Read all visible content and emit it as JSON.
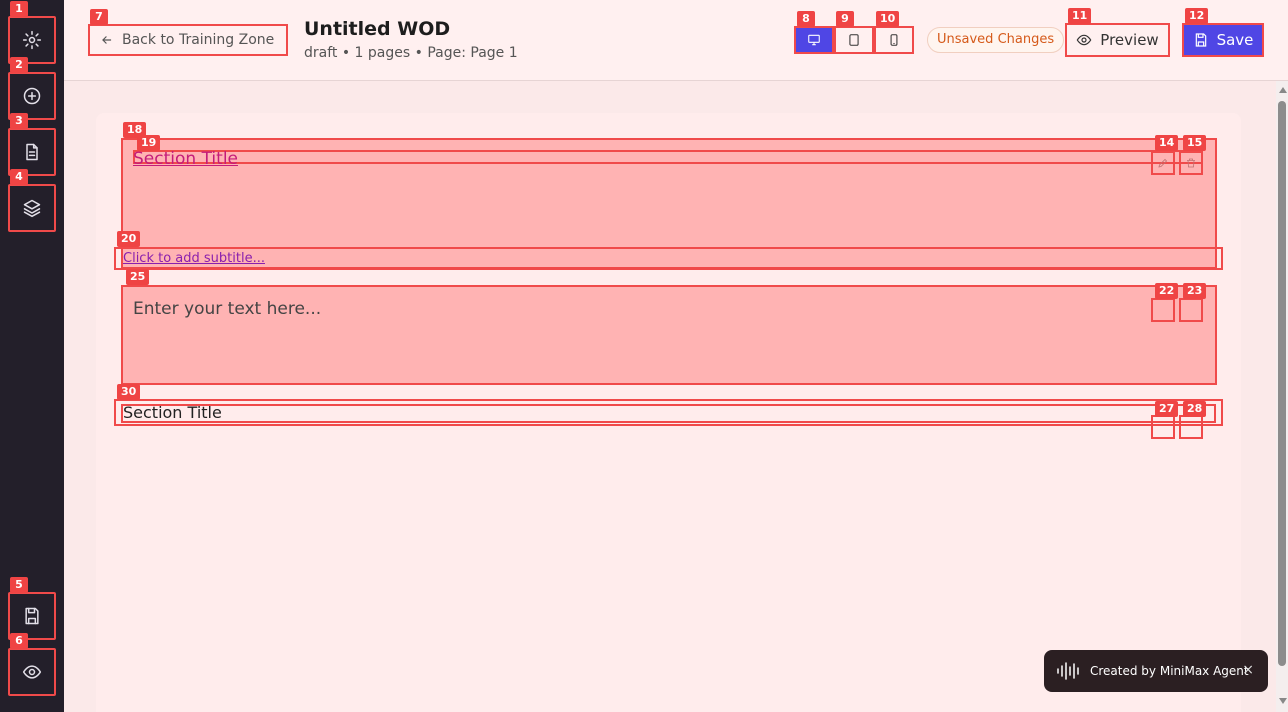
{
  "sidebar": {
    "items": [
      {
        "badge": "1",
        "icon": "gear-icon"
      },
      {
        "badge": "2",
        "icon": "plus-circle-icon"
      },
      {
        "badge": "3",
        "icon": "document-icon"
      },
      {
        "badge": "4",
        "icon": "layers-icon"
      },
      {
        "badge": "5",
        "icon": "save-icon"
      },
      {
        "badge": "6",
        "icon": "eye-icon"
      }
    ]
  },
  "header": {
    "back_badge": "7",
    "back_label": "Back to Training Zone",
    "title": "Untitled WOD",
    "meta": "draft • 1 pages • Page: Page 1",
    "device_badges": [
      "8",
      "9",
      "10"
    ],
    "status_badge": "Unsaved Changes",
    "preview_badge": "11",
    "preview_label": "Preview",
    "save_badge": "12",
    "save_label": "Save"
  },
  "editor": {
    "section1": {
      "block_badge": "18",
      "title_badge": "19",
      "title": "Section Title",
      "edit_badge": "14",
      "delete_badge": "15",
      "subtitle_badge": "20",
      "subtitle": "Click to add subtitle..."
    },
    "text_block": {
      "badge": "25",
      "placeholder": "Enter your text here...",
      "edit_badge": "22",
      "delete_badge": "23"
    },
    "section2": {
      "badge": "30",
      "title": "Section Title",
      "edit_badge": "27",
      "delete_badge": "28"
    }
  },
  "toast": {
    "text": "Created by MiniMax Agent",
    "close": "×"
  },
  "colors": {
    "accent": "#4f46e5",
    "sidebar_bg": "#231f2a",
    "annotation": "#f04a4a",
    "status": "#d55a1a"
  }
}
